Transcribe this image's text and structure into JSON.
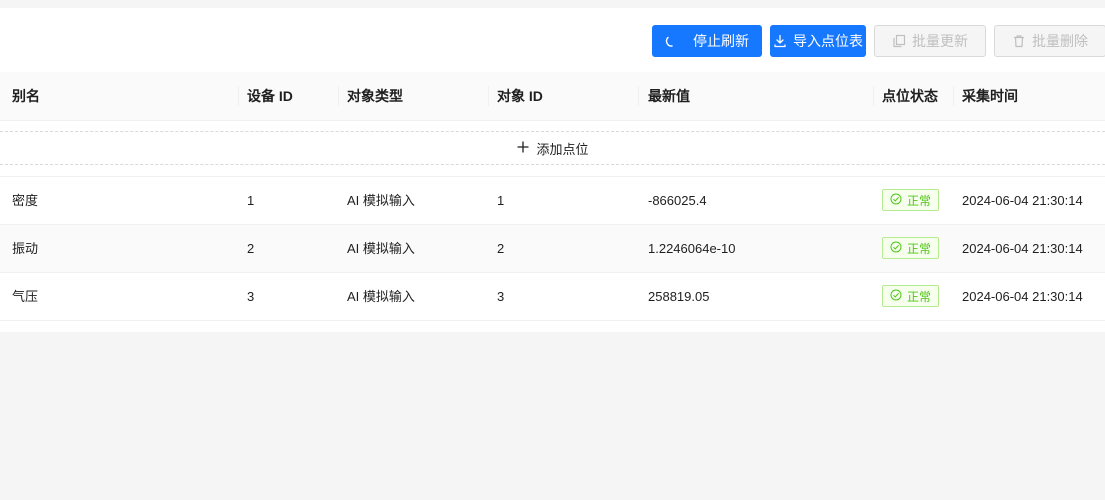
{
  "toolbar": {
    "stop_refresh": {
      "label": "停止刷新",
      "icon": "loading-icon"
    },
    "import_points": {
      "label": "导入点位表",
      "icon": "download-icon"
    },
    "batch_update": {
      "label": "批量更新",
      "icon": "copy-icon"
    },
    "batch_delete": {
      "label": "批量删除",
      "icon": "delete-icon"
    }
  },
  "table": {
    "columns": [
      "别名",
      "设备 ID",
      "对象类型",
      "对象 ID",
      "最新值",
      "点位状态",
      "采集时间"
    ],
    "add_point_label": "添加点位",
    "rows": [
      {
        "alias": "密度",
        "device_id": "1",
        "object_type": "AI 模拟输入",
        "object_id": "1",
        "value": "-866025.4",
        "status": "正常",
        "time": "2024-06-04 21:30:14"
      },
      {
        "alias": "振动",
        "device_id": "2",
        "object_type": "AI 模拟输入",
        "object_id": "2",
        "value": "1.2246064e-10",
        "status": "正常",
        "time": "2024-06-04 21:30:14"
      },
      {
        "alias": "气压",
        "device_id": "3",
        "object_type": "AI 模拟输入",
        "object_id": "3",
        "value": "258819.05",
        "status": "正常",
        "time": "2024-06-04 21:30:14"
      }
    ]
  },
  "colors": {
    "primary": "#1677ff",
    "success": "#52c41a",
    "success_bg": "#f6ffed",
    "success_border": "#b7eb8f"
  }
}
